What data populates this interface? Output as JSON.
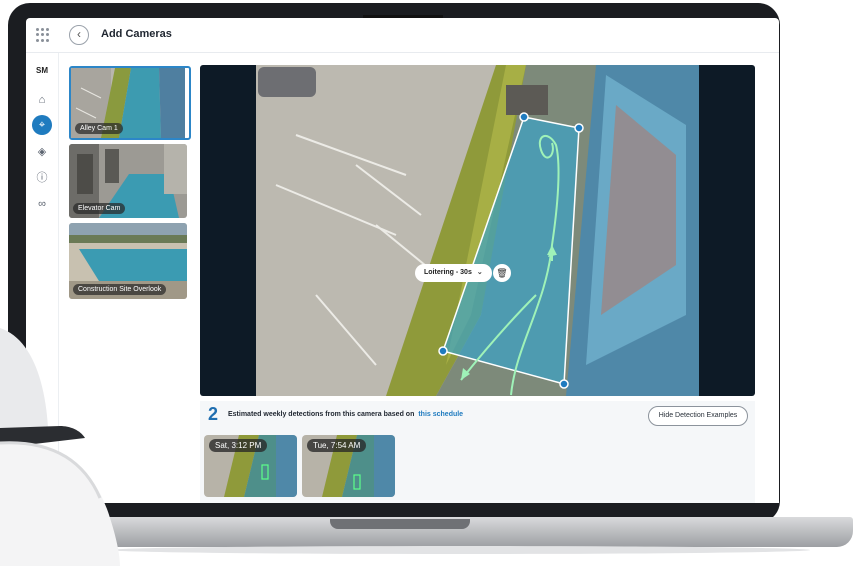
{
  "app": {
    "title": "Add Cameras",
    "user_initials": "SM"
  },
  "nav": {
    "icons": [
      "home-icon",
      "cameras-icon",
      "layers-icon",
      "alert-icon",
      "link-icon"
    ],
    "active": "cameras-icon"
  },
  "cameras": [
    {
      "name": "Alley Cam 1",
      "selected": true
    },
    {
      "name": "Elevator Cam",
      "selected": false
    },
    {
      "name": "Construction Site Overlook",
      "selected": false
    }
  ],
  "viewer": {
    "zone_label": "Loitering - 30s",
    "zone_color": "#3aa3c8"
  },
  "detections": {
    "count": "2",
    "text": "Estimated weekly detections from this camera based on",
    "link": "this schedule",
    "hide_button": "Hide Detection Examples",
    "examples": [
      {
        "timestamp": "Sat, 3:12 PM"
      },
      {
        "timestamp": "Tue, 7:54 AM"
      }
    ]
  },
  "colors": {
    "accent": "#1f7bbf",
    "zone": "#3aa3c8",
    "path": "#9ff2b8"
  }
}
